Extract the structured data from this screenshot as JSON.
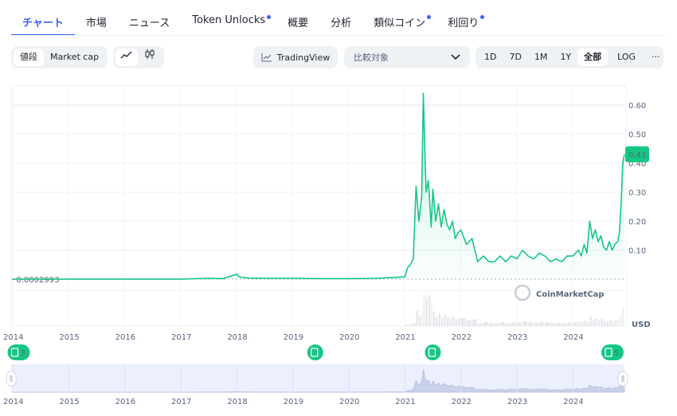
{
  "tabs": [
    {
      "label": "チャート",
      "active": true,
      "dot": false
    },
    {
      "label": "市場",
      "active": false,
      "dot": false
    },
    {
      "label": "ニュース",
      "active": false,
      "dot": false
    },
    {
      "label": "Token Unlocks",
      "active": false,
      "dot": true
    },
    {
      "label": "概要",
      "active": false,
      "dot": false
    },
    {
      "label": "分析",
      "active": false,
      "dot": false
    },
    {
      "label": "類似コイン",
      "active": false,
      "dot": true
    },
    {
      "label": "利回り",
      "active": false,
      "dot": true
    }
  ],
  "toolbar": {
    "value_type": {
      "price": "値段",
      "market_cap": "Market cap"
    },
    "tradingview_label": "TradingView",
    "compare_placeholder": "比較対象",
    "ranges": [
      "1D",
      "7D",
      "1M",
      "1Y",
      "全部"
    ],
    "active_range": "全部",
    "log_label": "LOG",
    "more_label": "···"
  },
  "colors": {
    "accent": "#3861fb",
    "line": "#16c784",
    "text_muted": "#58667e",
    "nav_bg": "#eceffd"
  },
  "chart_data": {
    "type": "area",
    "series": [
      {
        "x": [
          2014.0,
          2014.5,
          2015.0,
          2015.5,
          2016.0,
          2016.5,
          2017.0,
          2017.5,
          2017.75,
          2018.0,
          2018.04,
          2018.2,
          2018.5,
          2019.0,
          2019.5,
          2020.0,
          2020.5,
          2021.0,
          2021.05,
          2021.1,
          2021.15,
          2021.2,
          2021.25,
          2021.3,
          2021.33,
          2021.36,
          2021.38,
          2021.42,
          2021.47,
          2021.5,
          2021.55,
          2021.6,
          2021.65,
          2021.7,
          2021.75,
          2021.8,
          2021.85,
          2021.9,
          2021.95,
          2022.0,
          2022.1,
          2022.2,
          2022.3,
          2022.4,
          2022.5,
          2022.6,
          2022.7,
          2022.8,
          2022.9,
          2023.0,
          2023.1,
          2023.2,
          2023.3,
          2023.4,
          2023.5,
          2023.6,
          2023.7,
          2023.8,
          2023.9,
          2024.0,
          2024.1,
          2024.15,
          2024.2,
          2024.25,
          2024.3,
          2024.35,
          2024.4,
          2024.45,
          2024.5,
          2024.55,
          2024.6,
          2024.65,
          2024.7,
          2024.75,
          2024.8,
          2024.83,
          2024.86,
          2024.89,
          2024.92
        ],
        "y": [
          0.0003,
          0.0003,
          0.0003,
          0.0004,
          0.0003,
          0.0004,
          0.0004,
          0.003,
          0.002,
          0.017,
          0.008,
          0.004,
          0.003,
          0.003,
          0.002,
          0.002,
          0.003,
          0.008,
          0.04,
          0.05,
          0.07,
          0.32,
          0.2,
          0.28,
          0.64,
          0.42,
          0.3,
          0.34,
          0.18,
          0.31,
          0.2,
          0.26,
          0.18,
          0.24,
          0.19,
          0.17,
          0.2,
          0.14,
          0.16,
          0.17,
          0.12,
          0.14,
          0.06,
          0.08,
          0.06,
          0.06,
          0.08,
          0.06,
          0.08,
          0.07,
          0.1,
          0.08,
          0.07,
          0.09,
          0.08,
          0.06,
          0.07,
          0.06,
          0.08,
          0.08,
          0.1,
          0.08,
          0.12,
          0.09,
          0.2,
          0.14,
          0.17,
          0.13,
          0.15,
          0.11,
          0.1,
          0.13,
          0.1,
          0.12,
          0.13,
          0.16,
          0.26,
          0.4,
          0.43
        ]
      }
    ],
    "x_ticks": [
      "2014",
      "2015",
      "2016",
      "2017",
      "2018",
      "2019",
      "2020",
      "2021",
      "2022",
      "2023",
      "2024"
    ],
    "y_ticks": [
      0.1,
      0.2,
      0.3,
      0.4,
      0.5,
      0.6
    ],
    "y_tick_labels": [
      "0.10",
      "0.20",
      "0.30",
      "0.40",
      "0.50",
      "0.60"
    ],
    "xlim": [
      2014.0,
      2024.92
    ],
    "ylim": [
      -0.03,
      0.66
    ],
    "start_value_label": "· 0.0002993",
    "current_value_label": "0.43",
    "current_value": 0.43,
    "start_value": 0.0002993,
    "volume_unit": "USD",
    "watermark": "CoinMarketCap",
    "event_markers": [
      {
        "x": 2014.05,
        "label": "3"
      },
      {
        "x": 2019.4,
        "label": ""
      },
      {
        "x": 2021.5,
        "label": ""
      },
      {
        "x": 2024.65,
        "label": "5"
      }
    ],
    "grid": true,
    "log_scale": false
  }
}
